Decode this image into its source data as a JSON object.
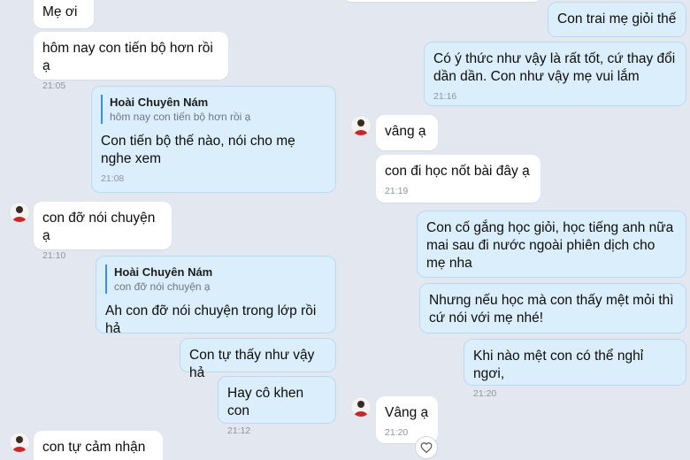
{
  "left": {
    "messages": [
      {
        "text": "Mẹ ơi",
        "time": ""
      },
      {
        "text": "hôm nay con tiến bộ hơn rồi ạ",
        "time": "21:05"
      },
      {
        "quote_name": "Hoài Chuyên Nám",
        "quote_text": "hôm nay con tiến bộ hơn rồi ạ",
        "text": "Con tiến bộ thế nào, nói cho mẹ nghe xem",
        "time": "21:08"
      },
      {
        "text": "con đỡ nói chuyện ạ",
        "time": "21:10"
      },
      {
        "quote_name": "Hoài Chuyên Nám",
        "quote_text": "con đỡ nói chuyện ạ",
        "text": "Ah con đỡ nói chuyện trong lớp rồi hả",
        "time": ""
      },
      {
        "text": "Con tự thấy như vậy hả",
        "time": ""
      },
      {
        "text": "Hay cô khen con",
        "time": "21:12"
      },
      {
        "text": "con tự cảm nhận ạ",
        "time": ""
      }
    ]
  },
  "right": {
    "messages": [
      {
        "text": "Con trai mẹ giỏi thế",
        "time": ""
      },
      {
        "text": "Có ý thức như vậy là rất tốt, cứ thay đổi dần dần. Con như vậy mẹ vui lắm",
        "time": "21:16"
      },
      {
        "text": "vâng ạ",
        "time": ""
      },
      {
        "text": "con đi học nốt bài đây ạ",
        "time": "21:19"
      },
      {
        "text": "Con cố gắng học giỏi, học tiếng anh nữa mai sau đi nước ngoài phiên dịch cho mẹ nha",
        "time": ""
      },
      {
        "text": "Nhưng nếu học mà con thấy mệt mỏi thì cứ nói với mẹ nhé!",
        "time": ""
      },
      {
        "text": "Khi nào mệt con có thể nghỉ ngơi,",
        "time": "21:20"
      },
      {
        "text": "Vâng ạ",
        "time": "21:20"
      }
    ]
  },
  "icons": {
    "avatar": "avatar-icon",
    "reaction": "heart-icon"
  },
  "colors": {
    "background": "#e3e8f0",
    "incoming": "#ffffff",
    "outgoing": "#dbeefc",
    "quote_bar": "#3a8ee6"
  }
}
